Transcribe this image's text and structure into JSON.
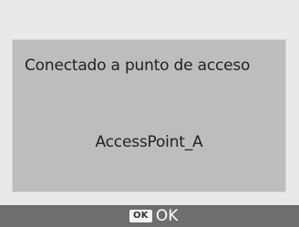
{
  "dialog": {
    "title": "Conectado a punto de acceso",
    "access_point_name": "AccessPoint_A"
  },
  "footer": {
    "ok_key_label": "OK",
    "ok_action_label": "OK"
  },
  "colors": {
    "background": "#e9e9e9",
    "dialog_background": "#bdbdbd",
    "footer_background": "#6e6e6e",
    "text": "#222222"
  }
}
